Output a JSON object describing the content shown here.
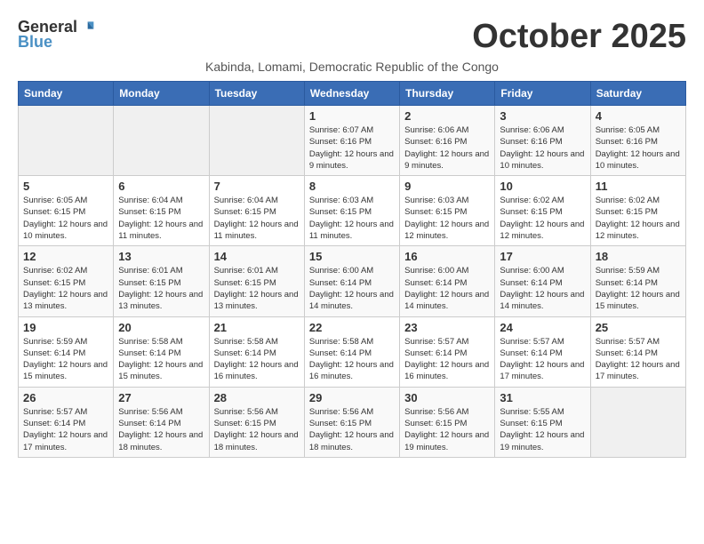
{
  "header": {
    "logo_general": "General",
    "logo_blue": "Blue",
    "month_title": "October 2025",
    "subtitle": "Kabinda, Lomami, Democratic Republic of the Congo"
  },
  "weekdays": [
    "Sunday",
    "Monday",
    "Tuesday",
    "Wednesday",
    "Thursday",
    "Friday",
    "Saturday"
  ],
  "weeks": [
    [
      {
        "day": "",
        "sunrise": "",
        "sunset": "",
        "daylight": ""
      },
      {
        "day": "",
        "sunrise": "",
        "sunset": "",
        "daylight": ""
      },
      {
        "day": "",
        "sunrise": "",
        "sunset": "",
        "daylight": ""
      },
      {
        "day": "1",
        "sunrise": "Sunrise: 6:07 AM",
        "sunset": "Sunset: 6:16 PM",
        "daylight": "Daylight: 12 hours and 9 minutes."
      },
      {
        "day": "2",
        "sunrise": "Sunrise: 6:06 AM",
        "sunset": "Sunset: 6:16 PM",
        "daylight": "Daylight: 12 hours and 9 minutes."
      },
      {
        "day": "3",
        "sunrise": "Sunrise: 6:06 AM",
        "sunset": "Sunset: 6:16 PM",
        "daylight": "Daylight: 12 hours and 10 minutes."
      },
      {
        "day": "4",
        "sunrise": "Sunrise: 6:05 AM",
        "sunset": "Sunset: 6:16 PM",
        "daylight": "Daylight: 12 hours and 10 minutes."
      }
    ],
    [
      {
        "day": "5",
        "sunrise": "Sunrise: 6:05 AM",
        "sunset": "Sunset: 6:15 PM",
        "daylight": "Daylight: 12 hours and 10 minutes."
      },
      {
        "day": "6",
        "sunrise": "Sunrise: 6:04 AM",
        "sunset": "Sunset: 6:15 PM",
        "daylight": "Daylight: 12 hours and 11 minutes."
      },
      {
        "day": "7",
        "sunrise": "Sunrise: 6:04 AM",
        "sunset": "Sunset: 6:15 PM",
        "daylight": "Daylight: 12 hours and 11 minutes."
      },
      {
        "day": "8",
        "sunrise": "Sunrise: 6:03 AM",
        "sunset": "Sunset: 6:15 PM",
        "daylight": "Daylight: 12 hours and 11 minutes."
      },
      {
        "day": "9",
        "sunrise": "Sunrise: 6:03 AM",
        "sunset": "Sunset: 6:15 PM",
        "daylight": "Daylight: 12 hours and 12 minutes."
      },
      {
        "day": "10",
        "sunrise": "Sunrise: 6:02 AM",
        "sunset": "Sunset: 6:15 PM",
        "daylight": "Daylight: 12 hours and 12 minutes."
      },
      {
        "day": "11",
        "sunrise": "Sunrise: 6:02 AM",
        "sunset": "Sunset: 6:15 PM",
        "daylight": "Daylight: 12 hours and 12 minutes."
      }
    ],
    [
      {
        "day": "12",
        "sunrise": "Sunrise: 6:02 AM",
        "sunset": "Sunset: 6:15 PM",
        "daylight": "Daylight: 12 hours and 13 minutes."
      },
      {
        "day": "13",
        "sunrise": "Sunrise: 6:01 AM",
        "sunset": "Sunset: 6:15 PM",
        "daylight": "Daylight: 12 hours and 13 minutes."
      },
      {
        "day": "14",
        "sunrise": "Sunrise: 6:01 AM",
        "sunset": "Sunset: 6:15 PM",
        "daylight": "Daylight: 12 hours and 13 minutes."
      },
      {
        "day": "15",
        "sunrise": "Sunrise: 6:00 AM",
        "sunset": "Sunset: 6:14 PM",
        "daylight": "Daylight: 12 hours and 14 minutes."
      },
      {
        "day": "16",
        "sunrise": "Sunrise: 6:00 AM",
        "sunset": "Sunset: 6:14 PM",
        "daylight": "Daylight: 12 hours and 14 minutes."
      },
      {
        "day": "17",
        "sunrise": "Sunrise: 6:00 AM",
        "sunset": "Sunset: 6:14 PM",
        "daylight": "Daylight: 12 hours and 14 minutes."
      },
      {
        "day": "18",
        "sunrise": "Sunrise: 5:59 AM",
        "sunset": "Sunset: 6:14 PM",
        "daylight": "Daylight: 12 hours and 15 minutes."
      }
    ],
    [
      {
        "day": "19",
        "sunrise": "Sunrise: 5:59 AM",
        "sunset": "Sunset: 6:14 PM",
        "daylight": "Daylight: 12 hours and 15 minutes."
      },
      {
        "day": "20",
        "sunrise": "Sunrise: 5:58 AM",
        "sunset": "Sunset: 6:14 PM",
        "daylight": "Daylight: 12 hours and 15 minutes."
      },
      {
        "day": "21",
        "sunrise": "Sunrise: 5:58 AM",
        "sunset": "Sunset: 6:14 PM",
        "daylight": "Daylight: 12 hours and 16 minutes."
      },
      {
        "day": "22",
        "sunrise": "Sunrise: 5:58 AM",
        "sunset": "Sunset: 6:14 PM",
        "daylight": "Daylight: 12 hours and 16 minutes."
      },
      {
        "day": "23",
        "sunrise": "Sunrise: 5:57 AM",
        "sunset": "Sunset: 6:14 PM",
        "daylight": "Daylight: 12 hours and 16 minutes."
      },
      {
        "day": "24",
        "sunrise": "Sunrise: 5:57 AM",
        "sunset": "Sunset: 6:14 PM",
        "daylight": "Daylight: 12 hours and 17 minutes."
      },
      {
        "day": "25",
        "sunrise": "Sunrise: 5:57 AM",
        "sunset": "Sunset: 6:14 PM",
        "daylight": "Daylight: 12 hours and 17 minutes."
      }
    ],
    [
      {
        "day": "26",
        "sunrise": "Sunrise: 5:57 AM",
        "sunset": "Sunset: 6:14 PM",
        "daylight": "Daylight: 12 hours and 17 minutes."
      },
      {
        "day": "27",
        "sunrise": "Sunrise: 5:56 AM",
        "sunset": "Sunset: 6:14 PM",
        "daylight": "Daylight: 12 hours and 18 minutes."
      },
      {
        "day": "28",
        "sunrise": "Sunrise: 5:56 AM",
        "sunset": "Sunset: 6:15 PM",
        "daylight": "Daylight: 12 hours and 18 minutes."
      },
      {
        "day": "29",
        "sunrise": "Sunrise: 5:56 AM",
        "sunset": "Sunset: 6:15 PM",
        "daylight": "Daylight: 12 hours and 18 minutes."
      },
      {
        "day": "30",
        "sunrise": "Sunrise: 5:56 AM",
        "sunset": "Sunset: 6:15 PM",
        "daylight": "Daylight: 12 hours and 19 minutes."
      },
      {
        "day": "31",
        "sunrise": "Sunrise: 5:55 AM",
        "sunset": "Sunset: 6:15 PM",
        "daylight": "Daylight: 12 hours and 19 minutes."
      },
      {
        "day": "",
        "sunrise": "",
        "sunset": "",
        "daylight": ""
      }
    ]
  ]
}
